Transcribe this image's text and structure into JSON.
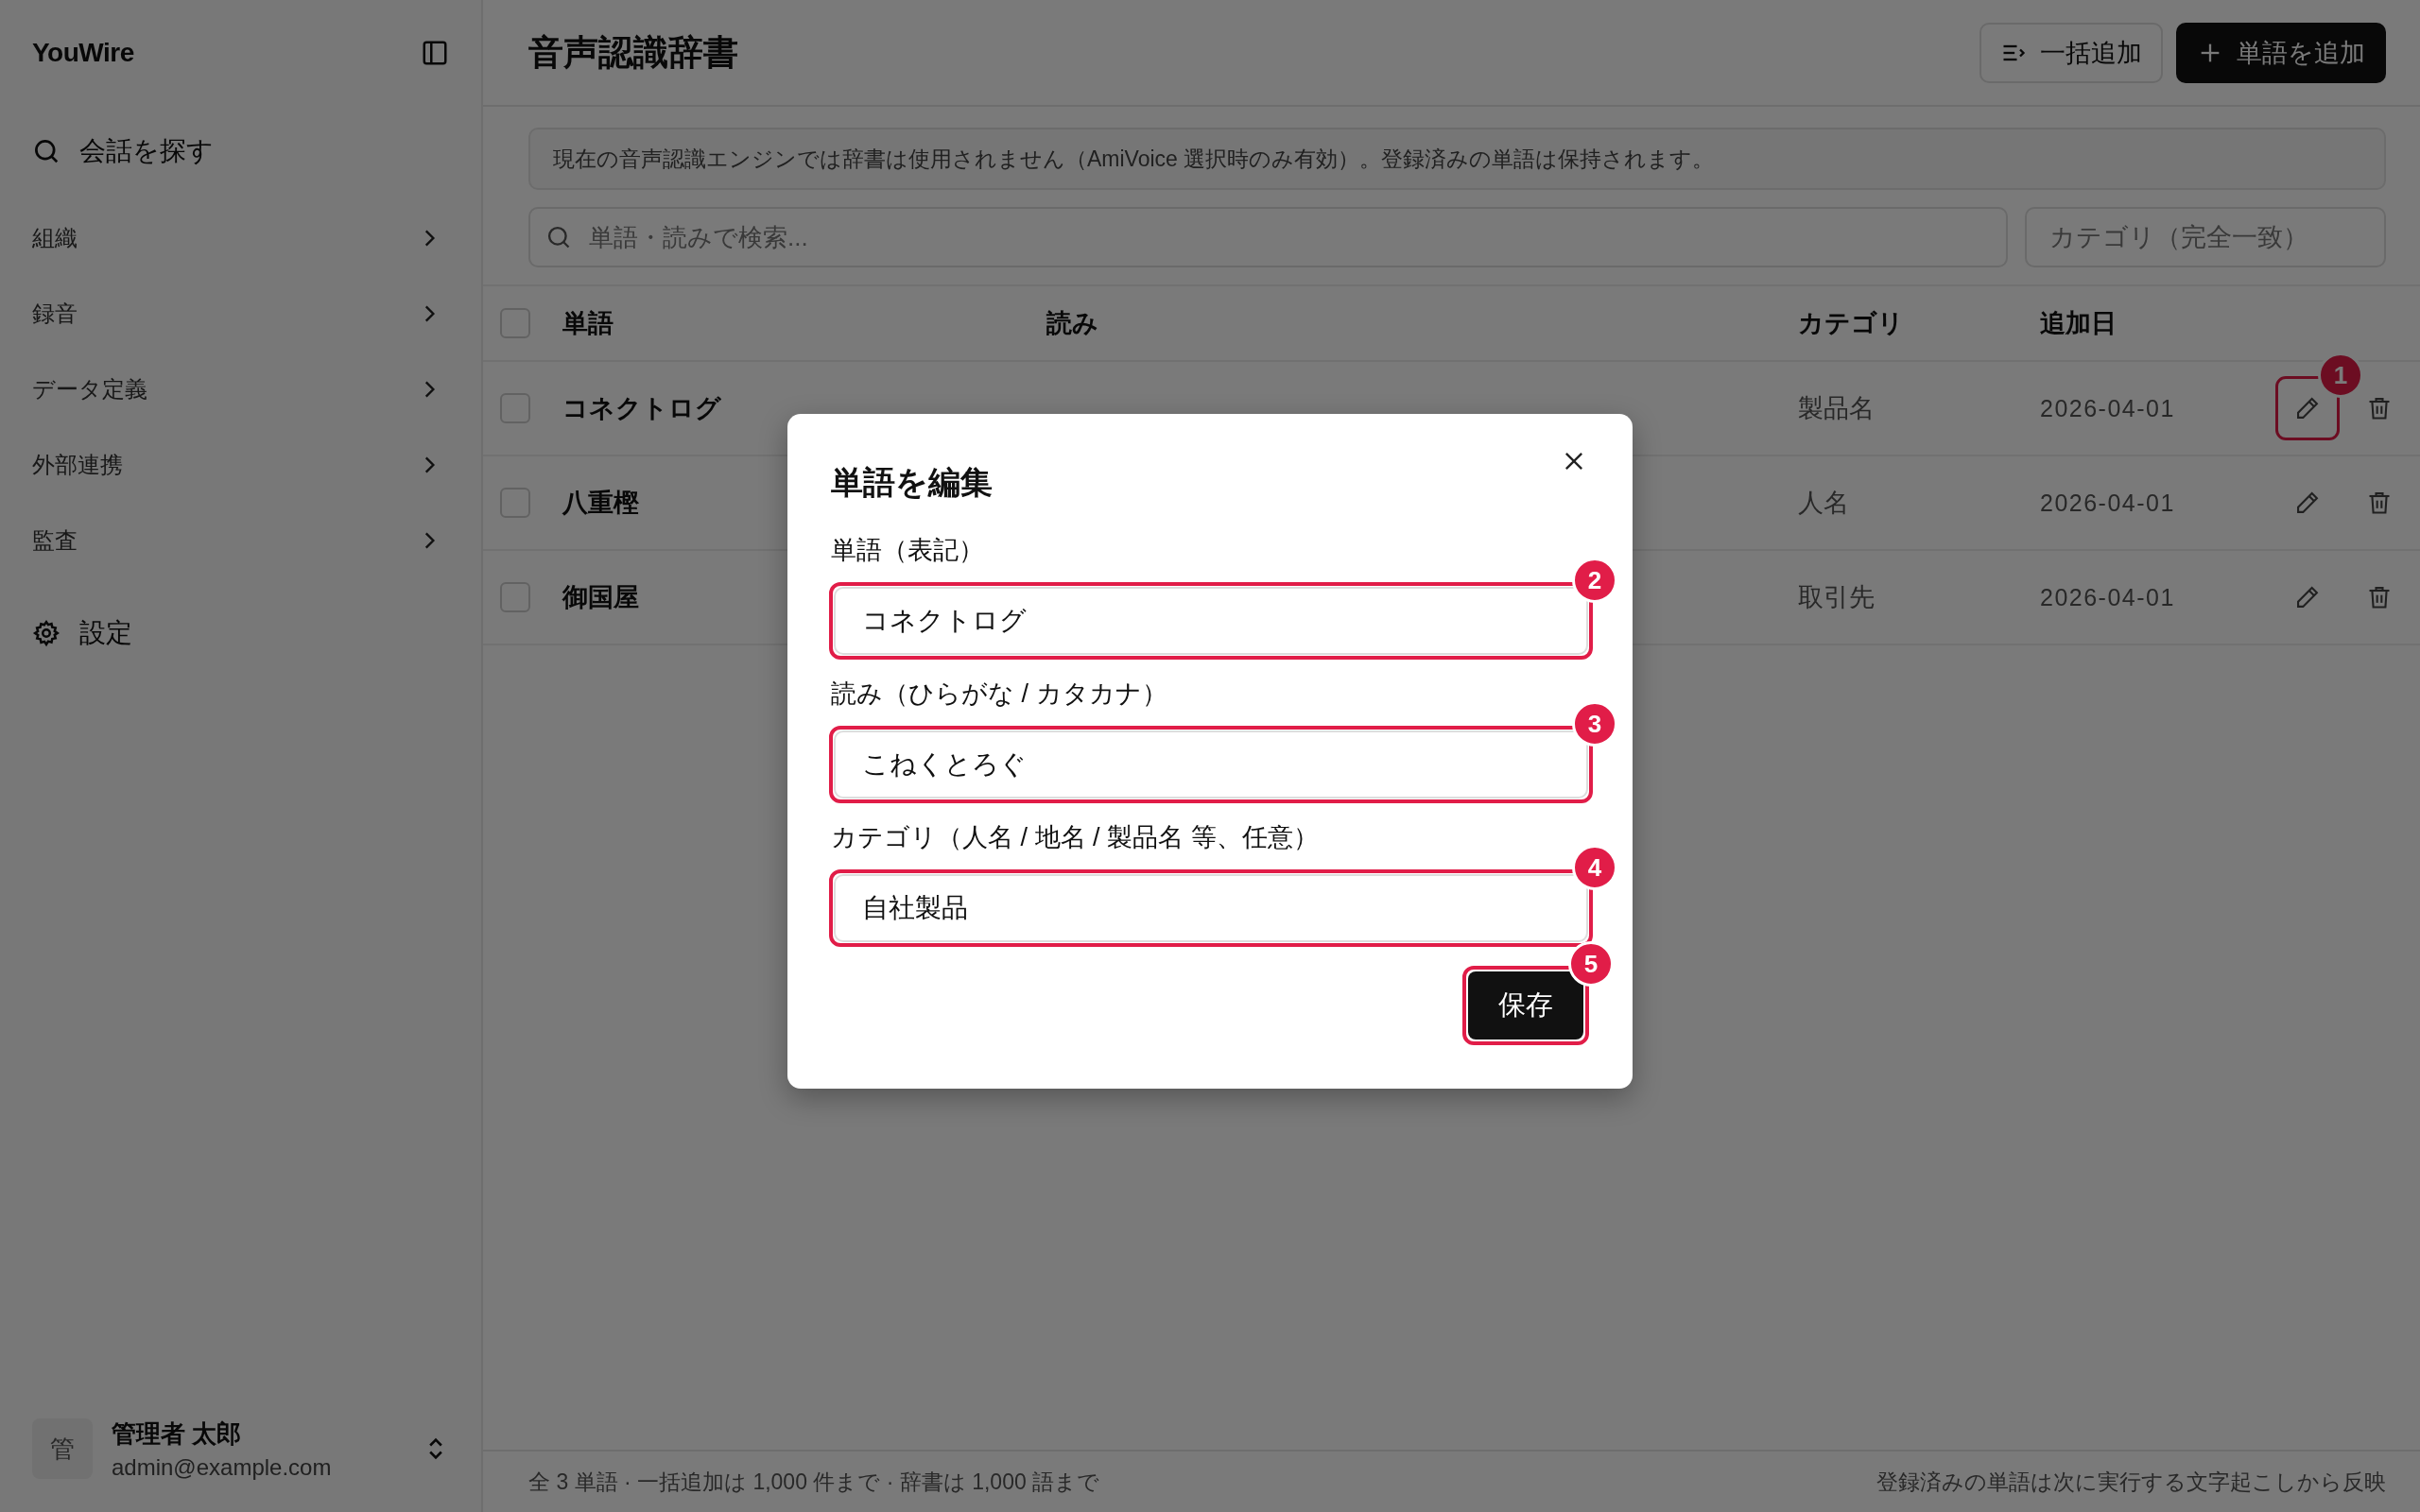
{
  "sidebar": {
    "brand": "YouWire",
    "search_label": "会話を探す",
    "sections": [
      {
        "label": "組織"
      },
      {
        "label": "録音"
      },
      {
        "label": "データ定義"
      },
      {
        "label": "外部連携"
      },
      {
        "label": "監査"
      }
    ],
    "settings_label": "設定",
    "user": {
      "avatar": "管",
      "name": "管理者 太郎",
      "email": "admin@example.com"
    }
  },
  "page": {
    "title": "音声認識辞書",
    "actions": [
      {
        "kind": "bulk",
        "label": "一括追加"
      },
      {
        "kind": "add",
        "label": "単語を追加"
      }
    ],
    "notice": "現在の音声認識エンジンでは辞書は使用されません（AmiVoice 選択時のみ有効）。登録済みの単語は保持されます。",
    "search": {
      "placeholder": "単語・読みで検索..."
    },
    "category_filter": {
      "placeholder": "カテゴリ（完全一致）"
    }
  },
  "table": {
    "columns": [
      "単語",
      "読み",
      "カテゴリ",
      "追加日"
    ],
    "rows": [
      {
        "word": "コネクトログ",
        "category": "製品名",
        "date": "2026-04-01",
        "edit_callout": "1",
        "checked": false
      },
      {
        "word": "八重樫",
        "category": "人名",
        "date": "2026-04-01",
        "checked": false
      },
      {
        "word": "御国屋",
        "category": "取引先",
        "date": "2026-04-01",
        "checked": false
      }
    ],
    "all_checked": false
  },
  "footer": {
    "summary": "全 3 単語 · 一括追加は 1,000 件まで · 辞書は 1,000 語まで",
    "note": "登録済みの単語は次に実行する文字起こしから反映"
  },
  "dialog": {
    "title": "単語を編集",
    "fields": [
      {
        "label": "単語（表記）",
        "value": "コネクトログ",
        "callout": "2"
      },
      {
        "label": "読み（ひらがな / カタカナ）",
        "value": "こねくとろぐ",
        "callout": "3"
      },
      {
        "label": "カテゴリ（人名 / 地名 / 製品名 等、任意）",
        "value": "自社製品",
        "callout": "4"
      }
    ],
    "save": {
      "label": "保存",
      "callout": "5"
    }
  }
}
